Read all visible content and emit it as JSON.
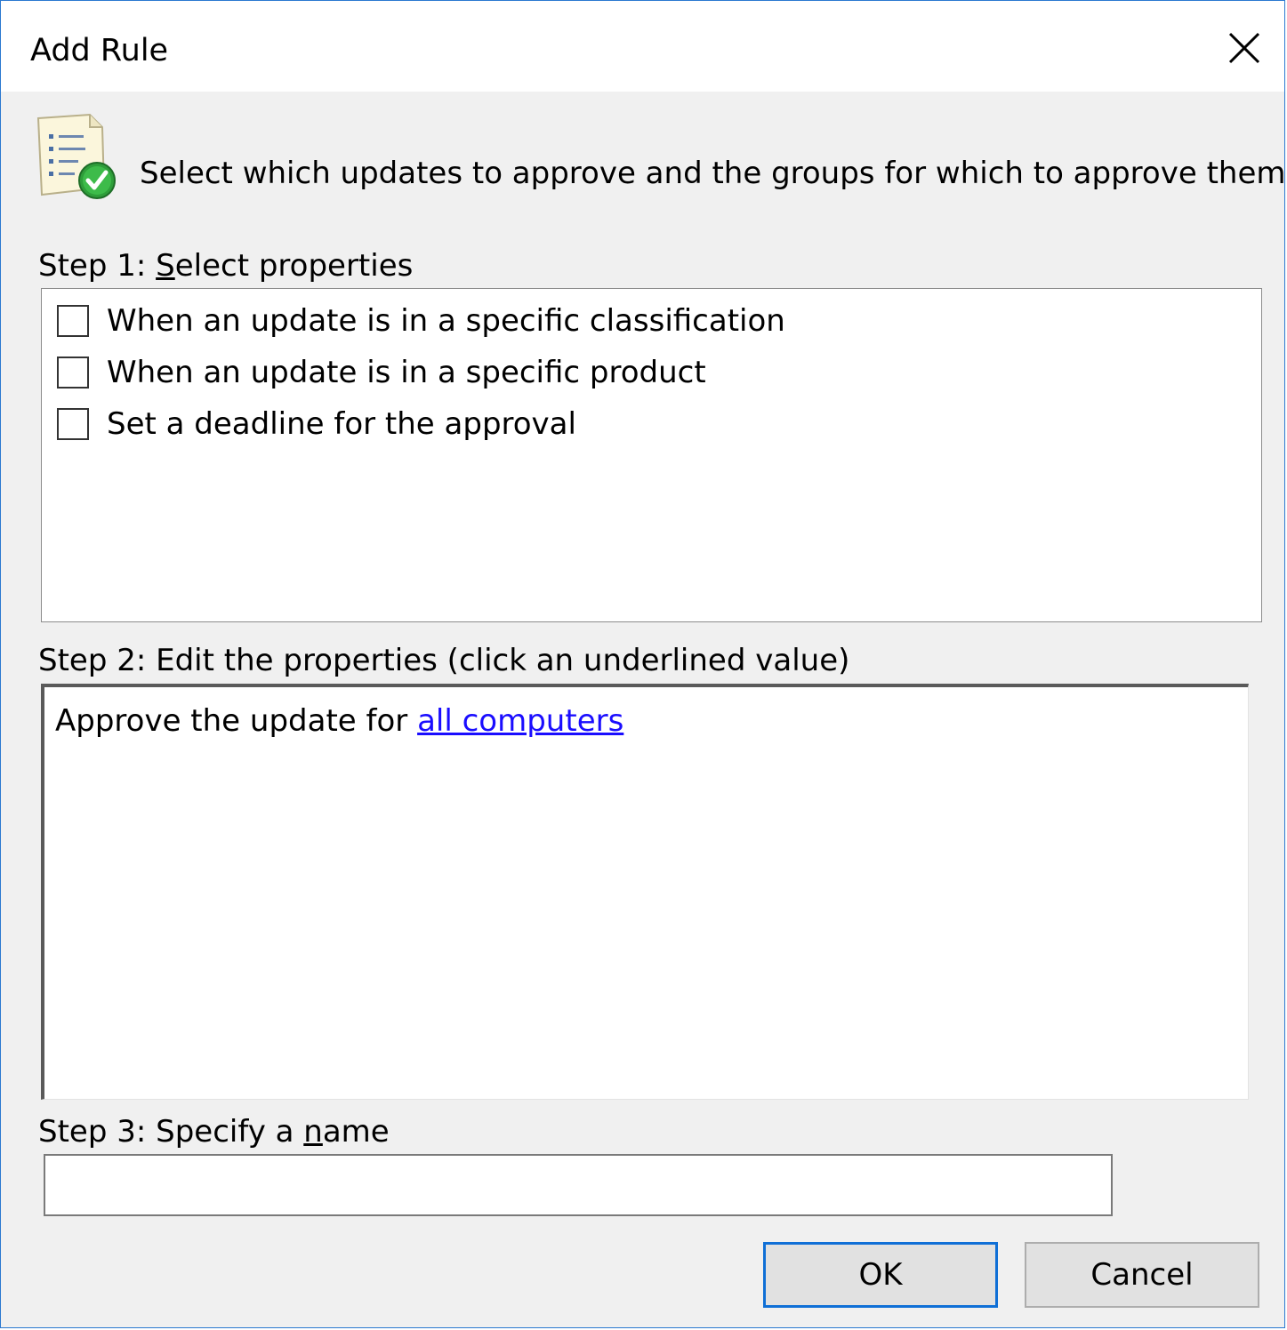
{
  "window": {
    "title": "Add Rule",
    "close_icon": "close-icon"
  },
  "header": {
    "icon": "rule-document-check-icon",
    "text": "Select which updates to approve and the groups for which to approve them."
  },
  "step1": {
    "label_prefix": "Step 1: ",
    "label_key": "S",
    "label_rest": "elect properties",
    "items": [
      {
        "label": "When an update is in a specific classification",
        "checked": false
      },
      {
        "label": "When an update is in a specific product",
        "checked": false
      },
      {
        "label": "Set a deadline for the approval",
        "checked": false
      }
    ]
  },
  "step2": {
    "label": "Step 2: Edit the properties (click an underlined value)",
    "text": "Approve the update for ",
    "link": "all computers"
  },
  "step3": {
    "label_prefix": "Step 3: Specify a ",
    "label_key": "n",
    "label_rest": "ame",
    "name_value": "",
    "name_placeholder": ""
  },
  "buttons": {
    "ok": "OK",
    "cancel": "Cancel"
  },
  "colors": {
    "accent": "#0f6fd6",
    "link": "#1a0dff",
    "window_border": "#2b79d0",
    "dialog_bg": "#f0f0f0"
  }
}
